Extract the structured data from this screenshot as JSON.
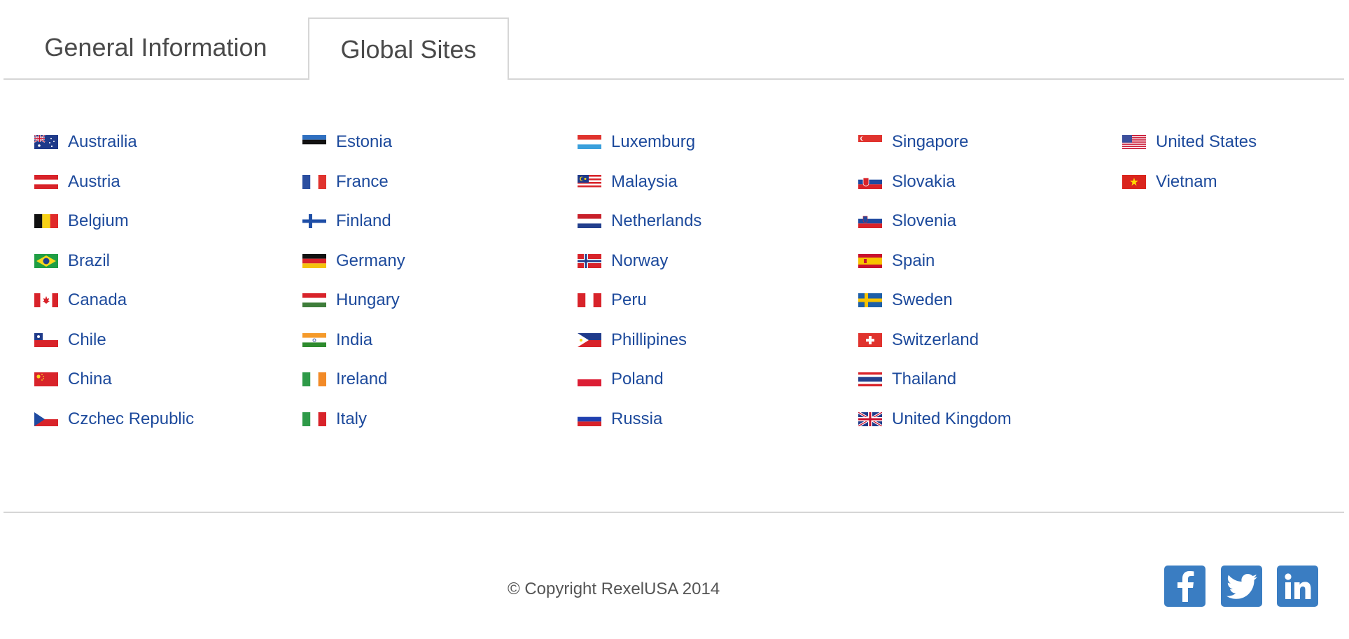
{
  "tabs": [
    {
      "label": "General Information",
      "active": false
    },
    {
      "label": "Global Sites",
      "active": true
    }
  ],
  "sites": {
    "columns": [
      [
        {
          "name": "Austrailia",
          "flag": "flag-australia"
        },
        {
          "name": "Austria",
          "flag": "flag-austria"
        },
        {
          "name": "Belgium",
          "flag": "flag-belgium"
        },
        {
          "name": "Brazil",
          "flag": "flag-brazil"
        },
        {
          "name": "Canada",
          "flag": "flag-canada"
        },
        {
          "name": "Chile",
          "flag": "flag-chile"
        },
        {
          "name": "China",
          "flag": "flag-china"
        },
        {
          "name": "Czchec Republic",
          "flag": "flag-czech-republic"
        }
      ],
      [
        {
          "name": "Estonia",
          "flag": "flag-estonia"
        },
        {
          "name": "France",
          "flag": "flag-france"
        },
        {
          "name": "Finland",
          "flag": "flag-finland"
        },
        {
          "name": "Germany",
          "flag": "flag-germany"
        },
        {
          "name": "Hungary",
          "flag": "flag-hungary"
        },
        {
          "name": "India",
          "flag": "flag-india"
        },
        {
          "name": "Ireland",
          "flag": "flag-ireland"
        },
        {
          "name": "Italy",
          "flag": "flag-italy"
        }
      ],
      [
        {
          "name": "Luxemburg",
          "flag": "flag-luxembourg"
        },
        {
          "name": "Malaysia",
          "flag": "flag-malaysia"
        },
        {
          "name": "Netherlands",
          "flag": "flag-netherlands"
        },
        {
          "name": "Norway",
          "flag": "flag-norway"
        },
        {
          "name": "Peru",
          "flag": "flag-peru"
        },
        {
          "name": "Phillipines",
          "flag": "flag-philippines"
        },
        {
          "name": "Poland",
          "flag": "flag-poland"
        },
        {
          "name": "Russia",
          "flag": "flag-russia"
        }
      ],
      [
        {
          "name": "Singapore",
          "flag": "flag-singapore"
        },
        {
          "name": "Slovakia",
          "flag": "flag-slovakia"
        },
        {
          "name": "Slovenia",
          "flag": "flag-slovenia"
        },
        {
          "name": "Spain",
          "flag": "flag-spain"
        },
        {
          "name": "Sweden",
          "flag": "flag-sweden"
        },
        {
          "name": "Switzerland",
          "flag": "flag-switzerland"
        },
        {
          "name": "Thailand",
          "flag": "flag-thailand"
        },
        {
          "name": "United Kingdom",
          "flag": "flag-united-kingdom"
        }
      ],
      [
        {
          "name": "United States",
          "flag": "flag-united-states"
        },
        {
          "name": "Vietnam",
          "flag": "flag-vietnam"
        }
      ]
    ]
  },
  "footer": {
    "copyright": "© Copyright RexelUSA 2014",
    "social": [
      {
        "icon": "facebook-icon"
      },
      {
        "icon": "twitter-icon"
      },
      {
        "icon": "linkedin-icon"
      }
    ]
  },
  "colors": {
    "link": "#1d4a9c",
    "social_bg": "#3a7dc2",
    "divider": "#d6d6d6"
  }
}
